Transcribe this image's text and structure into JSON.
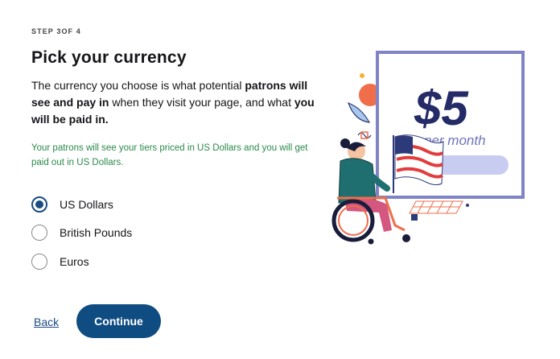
{
  "wizard": {
    "step_label": "STEP 3OF 4",
    "title": "Pick your currency",
    "description": {
      "part1": "The currency you choose is what potential ",
      "bold1": "patrons will see and pay in",
      "part2": " when they visit your page, and what ",
      "bold2": "you will be paid in."
    },
    "note": "Your patrons will see your tiers priced in US Dollars and you will get paid out in US Dollars."
  },
  "currency_options": [
    {
      "label": "US Dollars",
      "selected": true
    },
    {
      "label": "British Pounds",
      "selected": false
    },
    {
      "label": "Euros",
      "selected": false
    }
  ],
  "actions": {
    "back_label": "Back",
    "continue_label": "Continue"
  },
  "illustration": {
    "price": "$5",
    "period": "per month"
  },
  "colors": {
    "primary": "#0f4c82",
    "note_text": "#2a8a4a",
    "frame": "#7f84c6"
  }
}
